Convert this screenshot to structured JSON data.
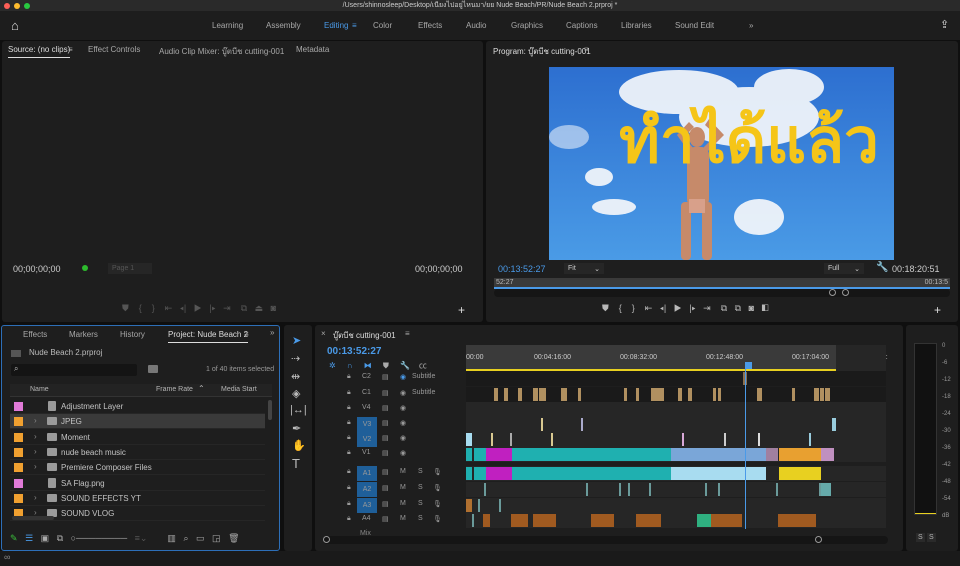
{
  "window": {
    "title": "/Users/shinnosleep/Desktop/เนียงไปอยู่ไหนมา/ยย Nude Beach/PR/Nude Beach 2.prproj *"
  },
  "workspaces": {
    "items": [
      "Learning",
      "Assembly",
      "Editing",
      "Color",
      "Effects",
      "Audio",
      "Graphics",
      "Captions",
      "Libraries",
      "Sound Edit"
    ],
    "active": "Editing",
    "more": "»"
  },
  "source": {
    "tabs": [
      "Source: (no clips)",
      "Effect Controls",
      "Audio Clip Mixer: บู๊ตบีช cutting-001",
      "Metadata"
    ],
    "timecode_left": "00;00;00;00",
    "timecode_right": "00;00;00;00",
    "page": "Page 1"
  },
  "program": {
    "tab": "Program: บู๊ตบีช cutting-001",
    "timecode": "00:13:52:27",
    "duration": "00:18:20:51",
    "zoom": "Fit",
    "resolution": "Full",
    "scrub_left": "52:27",
    "scrub_right": "00:13:5",
    "overlay_text": "ทำได้แล้ว"
  },
  "project": {
    "tabs": [
      "Effects",
      "Markers",
      "History",
      "Project: Nude Beach 2"
    ],
    "file": "Nude Beach 2.prproj",
    "search_placeholder": "",
    "selection": "1 of 40 items selected",
    "columns": [
      "Name",
      "Frame Rate",
      "Media Start"
    ],
    "items": [
      {
        "name": "Adjustment Layer",
        "color": "#e07ad8",
        "type": "file"
      },
      {
        "name": "JPEG",
        "color": "#f0a030",
        "type": "folder"
      },
      {
        "name": "Moment",
        "color": "#f0a030",
        "type": "folder"
      },
      {
        "name": "nude beach music",
        "color": "#f0a030",
        "type": "folder"
      },
      {
        "name": "Premiere Composer Files",
        "color": "#f0a030",
        "type": "folder"
      },
      {
        "name": "SA Flag.png",
        "color": "#e07ad8",
        "type": "file"
      },
      {
        "name": "SOUND EFFECTS YT",
        "color": "#f0a030",
        "type": "folder"
      },
      {
        "name": "SOUND VLOG",
        "color": "#f0a030",
        "type": "folder"
      }
    ]
  },
  "timeline": {
    "tab": "บู๊ตบีช cutting-001",
    "timecode": "00:13:52:27",
    "ruler": [
      "00:00",
      "00:04:16:00",
      "00:08:32:00",
      "00:12:48:00",
      "00:17:04:00",
      "00:"
    ],
    "tracks": [
      {
        "id": "C2",
        "label": "Subtitle"
      },
      {
        "id": "C1",
        "label": "Subtitle"
      },
      {
        "id": "V4"
      },
      {
        "id": "V3"
      },
      {
        "id": "V2"
      },
      {
        "id": "V1"
      },
      {
        "id": "A1"
      },
      {
        "id": "A2"
      },
      {
        "id": "A3"
      },
      {
        "id": "A4"
      }
    ],
    "mute": "M",
    "solo": "S",
    "mix": "Mix"
  },
  "meter": {
    "scale": [
      "0",
      "-6",
      "-12",
      "-18",
      "-24",
      "-30",
      "-36",
      "-42",
      "-48",
      "-54",
      "dB"
    ],
    "solo": [
      "S",
      "S"
    ]
  },
  "colors": {
    "accent": "#4a9ae8",
    "teal": "#1fb0b0",
    "magenta": "#c020c0",
    "blue_clip": "#7aa6d8",
    "orange": "#e8a030",
    "audio_light": "#a8dcf0"
  }
}
